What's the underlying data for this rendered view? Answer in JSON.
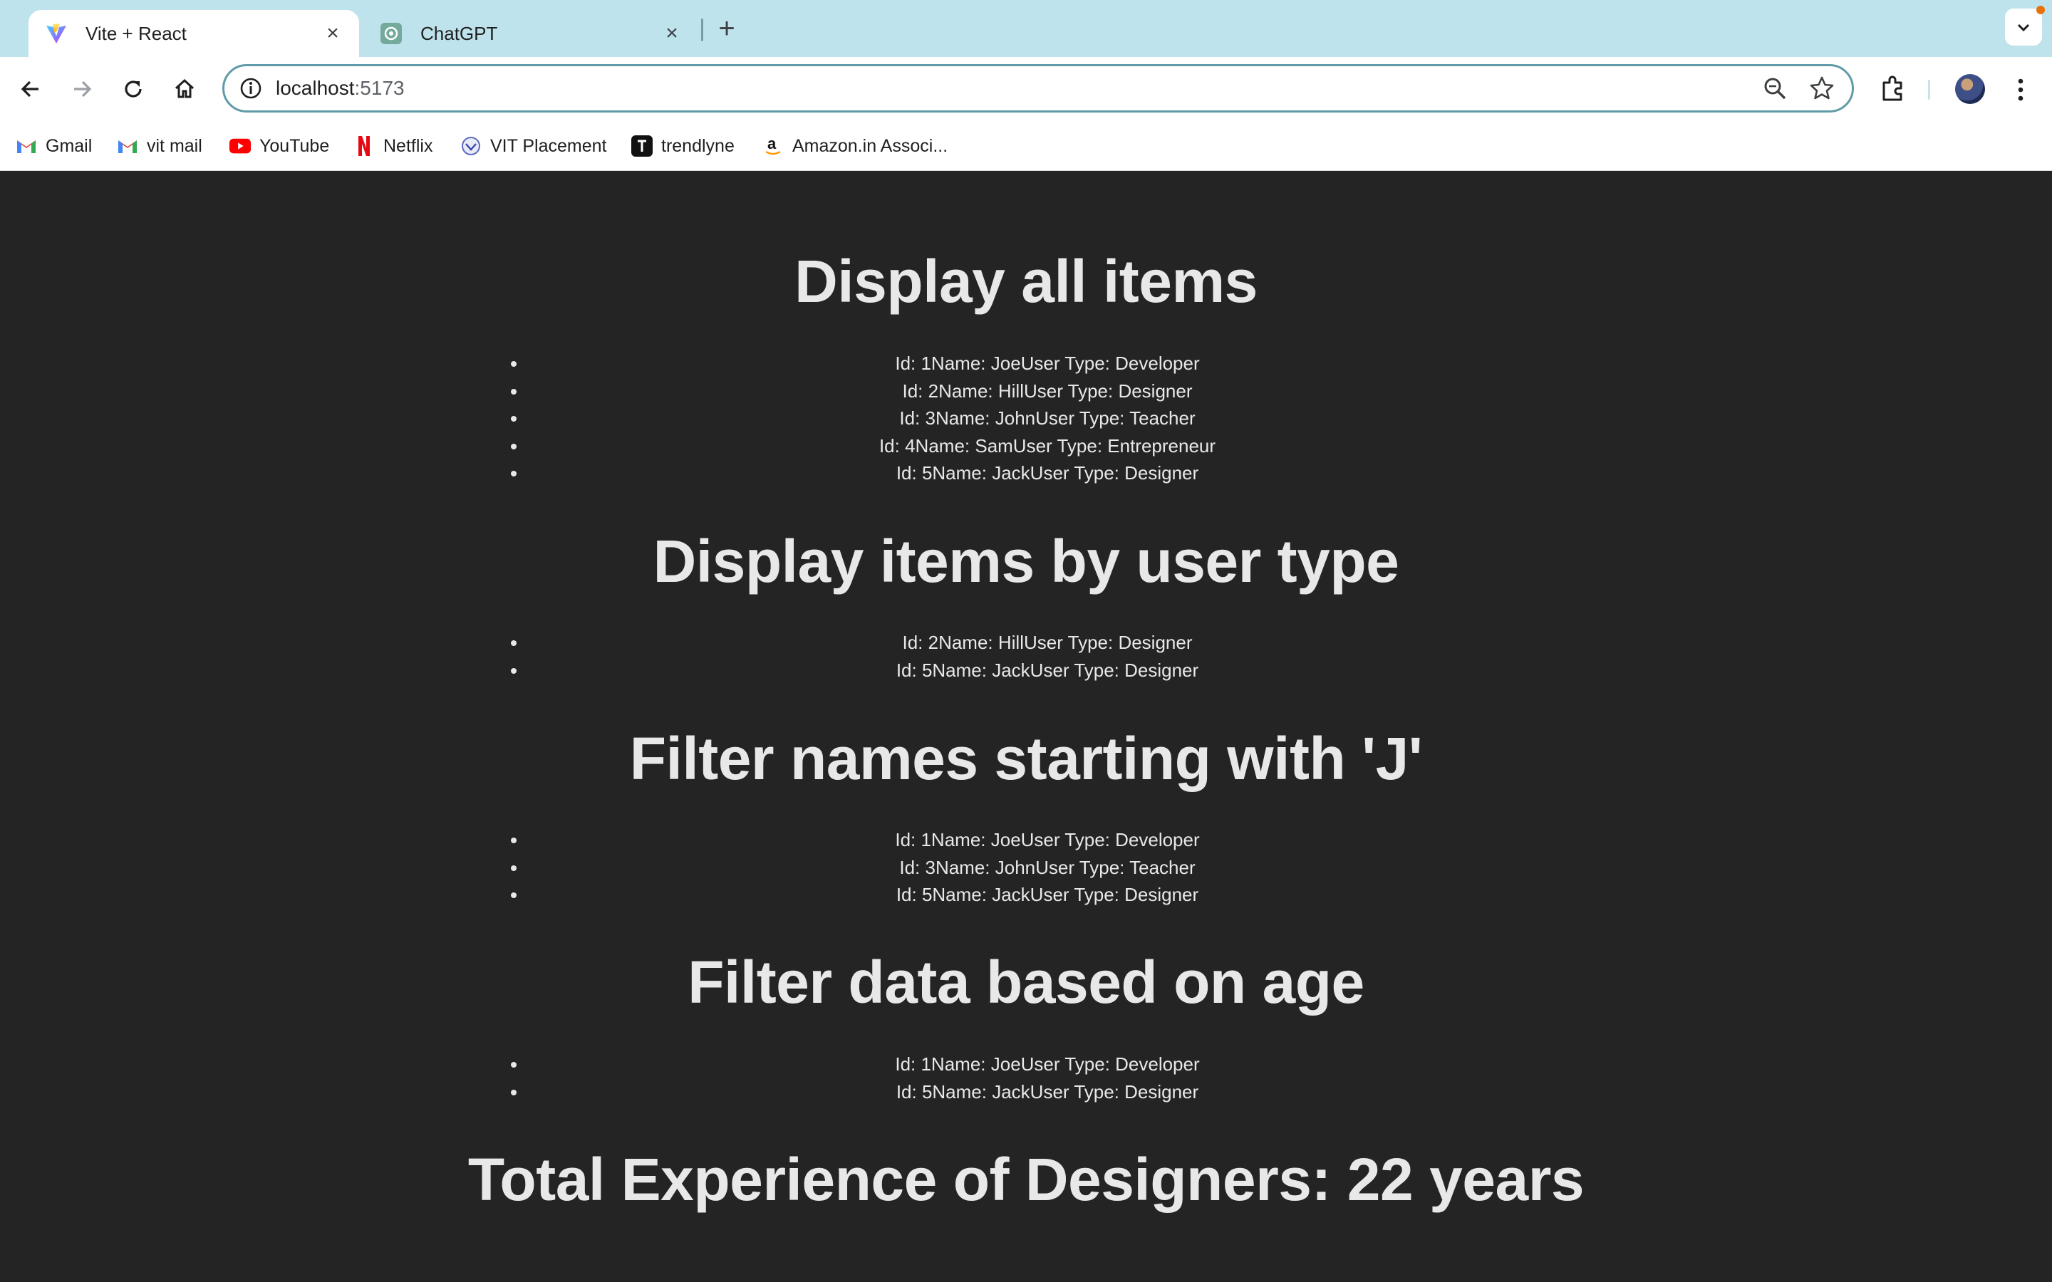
{
  "browser": {
    "tabs": [
      {
        "title": "Vite + React",
        "active": true
      },
      {
        "title": "ChatGPT",
        "active": false
      }
    ],
    "address": {
      "host": "localhost",
      "port": ":5173"
    },
    "bookmarks": [
      {
        "label": "Gmail",
        "icon": "gmail-icon"
      },
      {
        "label": "vit mail",
        "icon": "gmail-icon"
      },
      {
        "label": "YouTube",
        "icon": "youtube-icon"
      },
      {
        "label": "Netflix",
        "icon": "netflix-icon"
      },
      {
        "label": "VIT Placement",
        "icon": "vit-placement-icon"
      },
      {
        "label": "trendlyne",
        "icon": "trendlyne-icon"
      },
      {
        "label": "Amazon.in Associ...",
        "icon": "amazon-icon"
      }
    ]
  },
  "page": {
    "sections": [
      {
        "heading": "Display all items",
        "items": [
          "Id: 1Name: JoeUser Type: Developer",
          "Id: 2Name: HillUser Type: Designer",
          "Id: 3Name: JohnUser Type: Teacher",
          "Id: 4Name: SamUser Type: Entrepreneur",
          "Id: 5Name: JackUser Type: Designer"
        ]
      },
      {
        "heading": "Display items by user type",
        "items": [
          "Id: 2Name: HillUser Type: Designer",
          "Id: 5Name: JackUser Type: Designer"
        ]
      },
      {
        "heading": "Filter names starting with 'J'",
        "items": [
          "Id: 1Name: JoeUser Type: Developer",
          "Id: 3Name: JohnUser Type: Teacher",
          "Id: 5Name: JackUser Type: Designer"
        ]
      },
      {
        "heading": "Filter data based on age",
        "items": [
          "Id: 1Name: JoeUser Type: Developer",
          "Id: 5Name: JackUser Type: Designer"
        ]
      }
    ],
    "total": "Total Experience of Designers: 22 years"
  },
  "colors": {
    "page_background": "#242424",
    "text": "#e8e8e8",
    "tabbar": "#bfe3ec",
    "omnibox_border": "#5f9ba8"
  }
}
